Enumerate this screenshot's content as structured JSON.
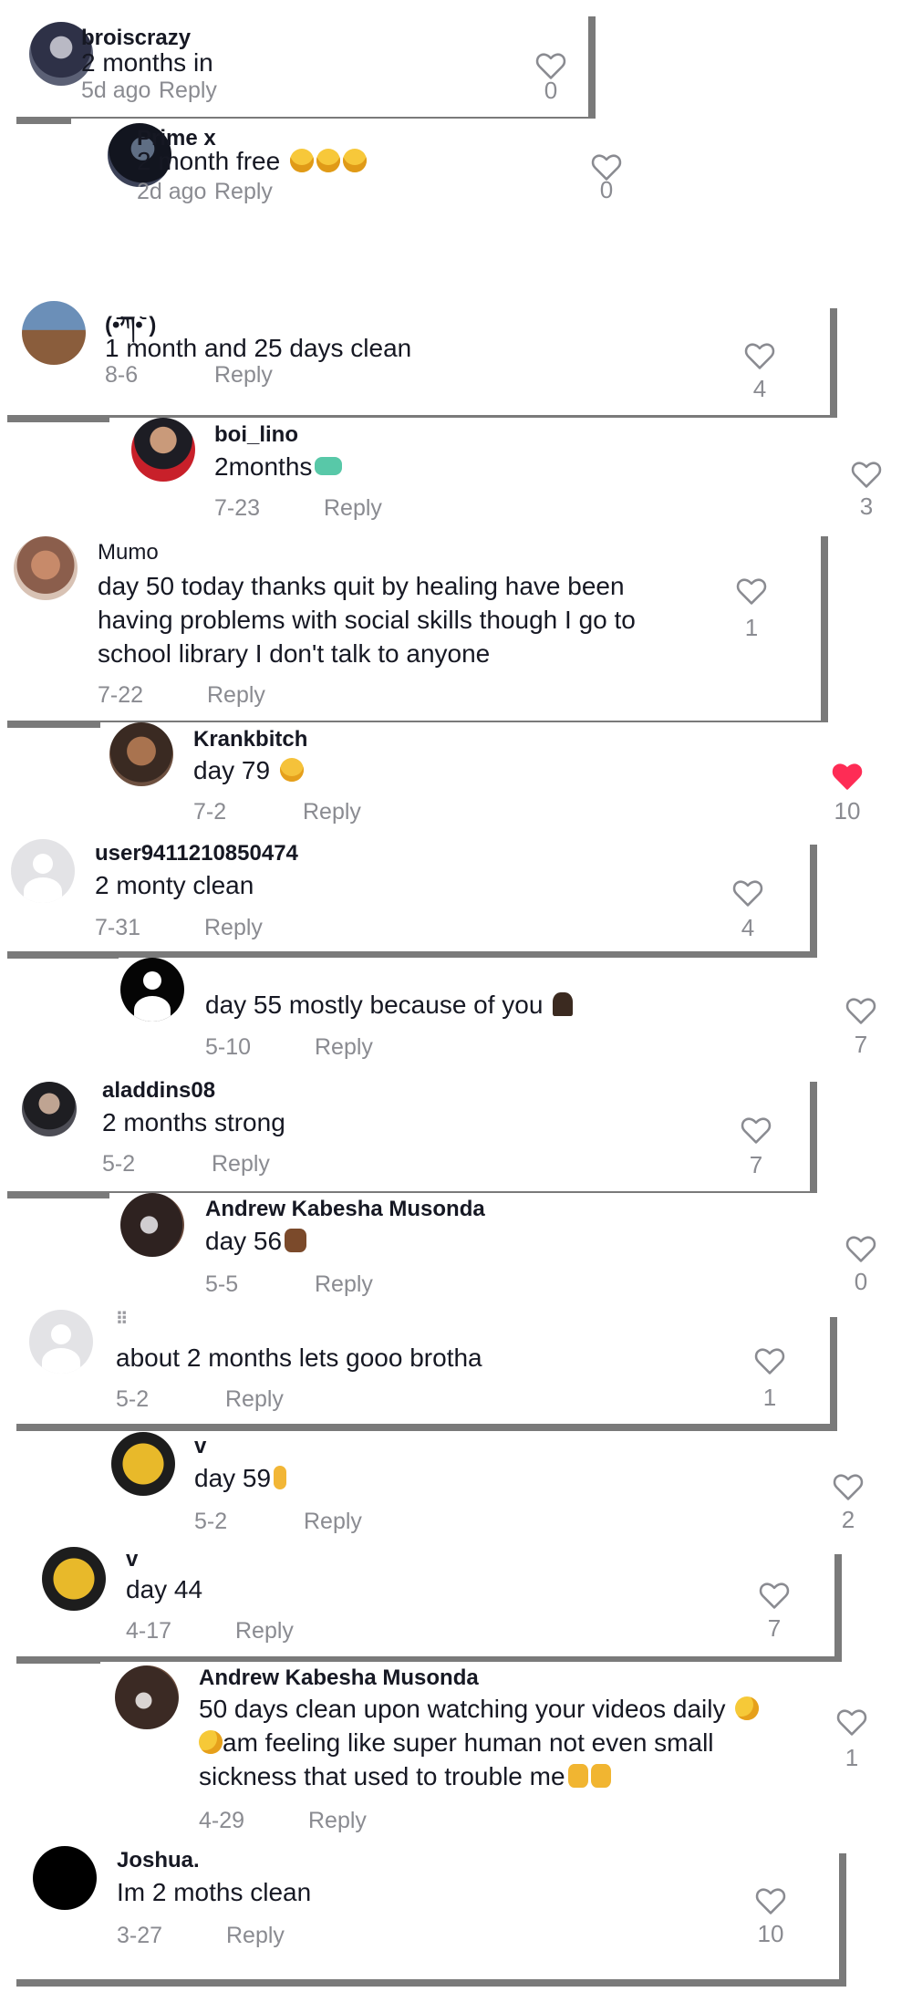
{
  "comments": [
    {
      "user": "broiscrazy",
      "text": "2 months in",
      "date": "5d ago",
      "reply": "Reply",
      "likes": "0",
      "liked": false
    },
    {
      "user": "Prime x",
      "text": "2 month free",
      "date": "2d ago",
      "reply": "Reply",
      "likes": "0",
      "liked": false
    },
    {
      "user": "(•᷄ཀ•᷅ )",
      "text": "1 month and 25 days clean",
      "date": "8-6",
      "reply": "Reply",
      "likes": "4",
      "liked": false
    },
    {
      "user": "boi_lino",
      "text": "2months",
      "date": "7-23",
      "reply": "Reply",
      "likes": "3",
      "liked": false
    },
    {
      "user": "Mumo",
      "text_lines": [
        "day 50 today thanks quit by healing have been",
        "having problems with social skills though I go to",
        "school library I don't talk to anyone"
      ],
      "date": "7-22",
      "reply": "Reply",
      "likes": "1",
      "liked": false
    },
    {
      "user": "Krankbitch",
      "text": "day 79",
      "date": "7-2",
      "reply": "Reply",
      "likes": "10",
      "liked": true
    },
    {
      "user": "user9411210850474",
      "text": "2 monty clean",
      "date": "7-31",
      "reply": "Reply",
      "likes": "4",
      "liked": false
    },
    {
      "user": "",
      "text": "day 55 mostly because of you",
      "date": "5-10",
      "reply": "Reply",
      "likes": "7",
      "liked": false
    },
    {
      "user": "aladdins08",
      "text": "2 months strong",
      "date": "5-2",
      "reply": "Reply",
      "likes": "7",
      "liked": false
    },
    {
      "user": "Andrew Kabesha Musonda",
      "text": "day 56",
      "date": "5-5",
      "reply": "Reply",
      "likes": "0",
      "liked": false
    },
    {
      "user": "⠿",
      "text": "about 2 months lets gooo brotha",
      "date": "5-2",
      "reply": "Reply",
      "likes": "1",
      "liked": false
    },
    {
      "user": "v",
      "text": "day 59",
      "date": "5-2",
      "reply": "Reply",
      "likes": "2",
      "liked": false
    },
    {
      "user": "v",
      "text": "day 44",
      "date": "4-17",
      "reply": "Reply",
      "likes": "7",
      "liked": false
    },
    {
      "user": "Andrew Kabesha Musonda",
      "text_lines": [
        "50 days clean upon watching your videos daily",
        "am feeling like super human not even small",
        "sickness that used to trouble me"
      ],
      "date": "4-29",
      "reply": "Reply",
      "likes": "1",
      "liked": false
    },
    {
      "user": "Joshua.",
      "text": "Im 2 moths clean",
      "date": "3-27",
      "reply": "Reply",
      "likes": "10",
      "liked": false
    }
  ],
  "emoji": {
    "grinning": "grinning-squinting-face-emoji",
    "soap": "soap-emoji",
    "wink": "winking-face-emoji",
    "pray": "folded-hands-emoji",
    "fist": "raised-fist-emoji",
    "crossed": "crossed-fingers-emoji",
    "sneeze": "sneezing-face-emoji"
  },
  "colors": {
    "text": "#161823",
    "muted": "#8a8b91",
    "liked": "#fe2c55",
    "shadow": "#7a7a7a"
  }
}
